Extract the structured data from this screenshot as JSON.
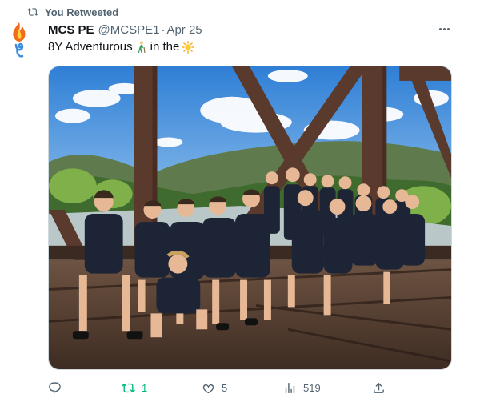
{
  "retweet_banner": {
    "text": "You Retweeted",
    "icon": "retweet-icon"
  },
  "author": {
    "name": "MCS PE",
    "handle": "@MCSPE1",
    "separator": "·",
    "date": "Apr 25",
    "avatar_icon": "flame-logo"
  },
  "tweet": {
    "text_part1": "8Y Adventurous",
    "text_part2": "in the",
    "emoji_1": "person-walking-with-cane-emoji",
    "emoji_2": "sun-emoji"
  },
  "media": {
    "description_icon": "photo",
    "accent_colors": {
      "sky": "#3f8fdf",
      "girder": "#5a3a2c",
      "uniform": "#1c2436"
    }
  },
  "actions": {
    "reply": {
      "icon": "reply-icon",
      "count": ""
    },
    "retweet": {
      "icon": "retweet-icon",
      "count": "1",
      "color": "#00ba7c"
    },
    "like": {
      "icon": "heart-icon",
      "count": "5"
    },
    "views": {
      "icon": "views-icon",
      "count": "519"
    },
    "share": {
      "icon": "share-icon",
      "count": ""
    }
  },
  "colors": {
    "text": "#0f1419",
    "secondary": "#536471",
    "border": "#cfd9de"
  }
}
